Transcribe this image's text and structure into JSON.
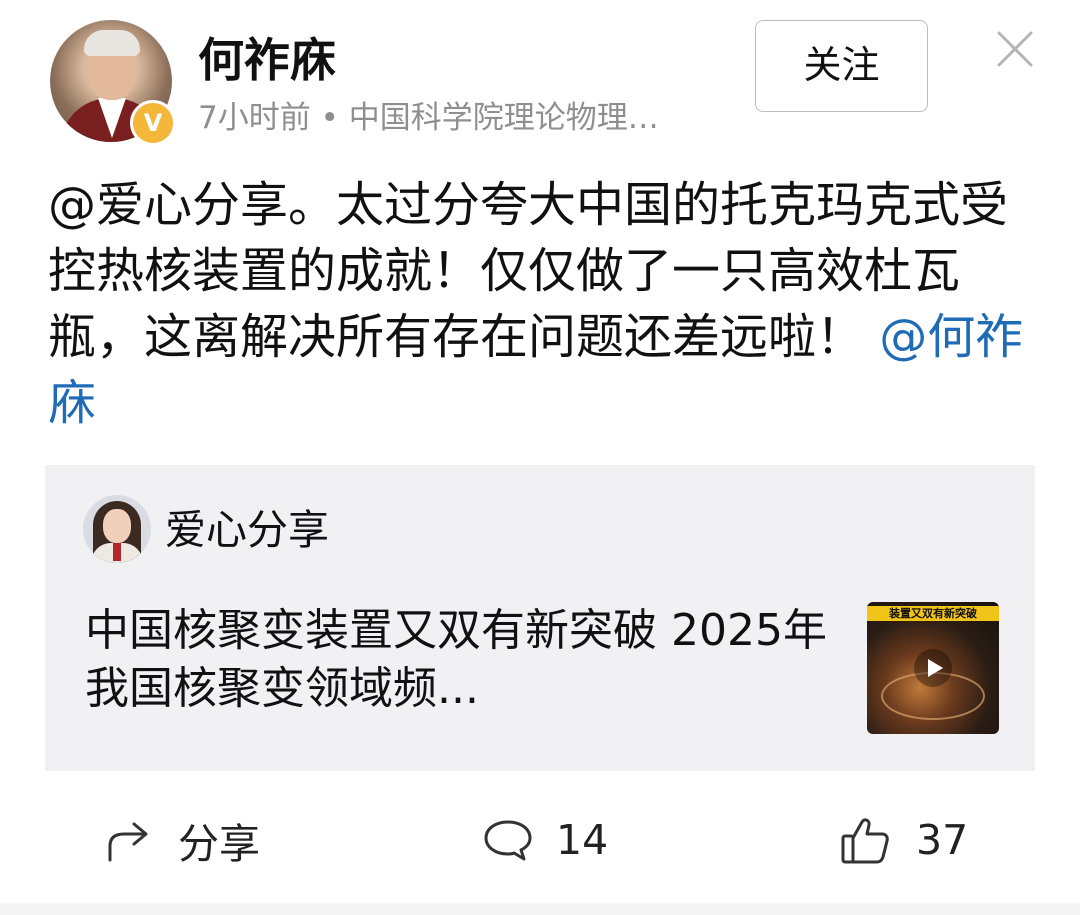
{
  "author": {
    "name": "何祚庥",
    "verified_mark": "V",
    "meta": "7小时前 • 中国科学院理论物理…"
  },
  "header": {
    "follow_label": "关注"
  },
  "post": {
    "text": "@爱心分享。太过分夸大中国的托克玛克式受控热核装置的成就！仅仅做了一只高效杜瓦瓶，这离解决所有存在问题还差远啦！",
    "mention": "@何祚庥"
  },
  "quoted": {
    "author": "爱心分享",
    "title": "中国核聚变装置又双有新突破 2025年我国核聚变领域频...",
    "thumbnail_caption": "装置又双有新突破"
  },
  "actions": {
    "share_label": "分享",
    "comment_count": "14",
    "like_count": "37"
  },
  "colors": {
    "mention": "#1f6bb6",
    "badge": "#f4b73a",
    "meta_text": "#8f8f8f",
    "card_bg": "#f1f1f3"
  },
  "icons": [
    "close-icon",
    "verified-badge-icon",
    "play-icon",
    "share-icon",
    "comment-icon",
    "like-icon"
  ]
}
